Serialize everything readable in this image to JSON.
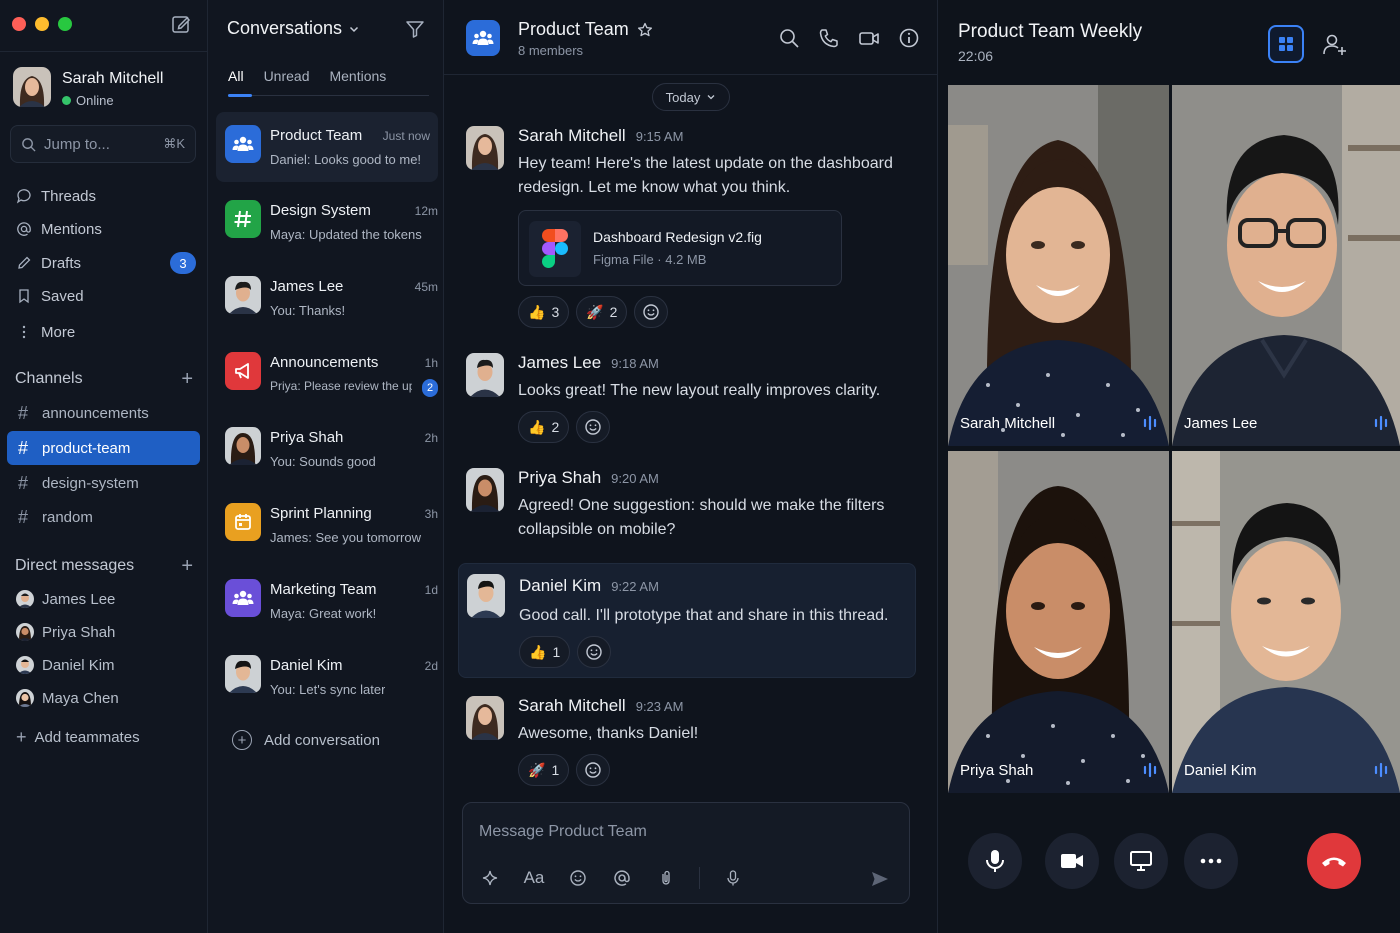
{
  "colors": {
    "accent": "#2b6cd9",
    "online": "#35c46a",
    "end_call": "#e0383b"
  },
  "user": {
    "name": "Sarah Mitchell",
    "status": "Online"
  },
  "search": {
    "placeholder": "Jump to...",
    "shortcut": "⌘K"
  },
  "nav": [
    {
      "label": "Threads",
      "icon": "threads-icon"
    },
    {
      "label": "Mentions",
      "icon": "at-icon"
    },
    {
      "label": "Drafts",
      "icon": "pencil-icon",
      "badge": "3"
    },
    {
      "label": "Saved",
      "icon": "bookmark-icon"
    },
    {
      "label": "More",
      "icon": "more-vertical-icon"
    }
  ],
  "channels": {
    "title": "Channels",
    "items": [
      "announcements",
      "product-team",
      "design-system",
      "random"
    ],
    "active": "product-team"
  },
  "dms": {
    "title": "Direct messages",
    "items": [
      "James Lee",
      "Priya Shah",
      "Daniel Kim",
      "Maya Chen"
    ],
    "add_label": "Add teammates"
  },
  "conversations": {
    "title": "Conversations",
    "tabs": [
      "All",
      "Unread",
      "Mentions"
    ],
    "items": [
      {
        "name": "Product Team",
        "time": "Just now",
        "preview": "Daniel: Looks good to me!",
        "icon": "people-icon",
        "color": "#2b6cd9"
      },
      {
        "name": "Design System",
        "time": "12m",
        "preview": "Maya: Updated the tokens",
        "icon": "hash-icon",
        "color": "#22a447"
      },
      {
        "name": "James Lee",
        "time": "45m",
        "preview": "You: Thanks!",
        "icon": "avatar"
      },
      {
        "name": "Announcements",
        "time": "1h",
        "preview": "Priya: Please review the upda...",
        "icon": "megaphone-icon",
        "color": "#e0383b",
        "badge": "2"
      },
      {
        "name": "Priya Shah",
        "time": "2h",
        "preview": "You: Sounds good",
        "icon": "avatar"
      },
      {
        "name": "Sprint Planning",
        "time": "3h",
        "preview": "James: See you tomorrow",
        "icon": "calendar-icon",
        "color": "#e9a020"
      },
      {
        "name": "Marketing Team",
        "time": "1d",
        "preview": "Maya: Great work!",
        "icon": "people-icon",
        "color": "#6a4fd8"
      },
      {
        "name": "Daniel Kim",
        "time": "2d",
        "preview": "You: Let's sync later",
        "icon": "avatar"
      }
    ],
    "add_label": "Add conversation"
  },
  "chat": {
    "title": "Product Team",
    "members": "8 members",
    "day": "Today",
    "messages": [
      {
        "author": "Sarah Mitchell",
        "time": "9:15 AM",
        "text": "Hey team! Here's the latest update on the dashboard redesign. Let me know what you think.",
        "file": {
          "name": "Dashboard Redesign v2.fig",
          "meta": "Figma File · 4.2 MB"
        },
        "reactions": [
          {
            "emoji": "👍",
            "count": "3"
          },
          {
            "emoji": "🚀",
            "count": "2"
          }
        ]
      },
      {
        "author": "James Lee",
        "time": "9:18 AM",
        "text": "Looks great! The new layout really improves clarity.",
        "reactions": [
          {
            "emoji": "👍",
            "count": "2"
          }
        ]
      },
      {
        "author": "Priya Shah",
        "time": "9:20 AM",
        "text": "Agreed! One suggestion: should we make the filters collapsible on mobile?"
      },
      {
        "author": "Daniel Kim",
        "time": "9:22 AM",
        "text": "Good call. I'll prototype that and share in this thread.",
        "reactions": [
          {
            "emoji": "👍",
            "count": "1"
          }
        ]
      },
      {
        "author": "Sarah Mitchell",
        "time": "9:23 AM",
        "text": "Awesome, thanks Daniel!",
        "reactions": [
          {
            "emoji": "🚀",
            "count": "1"
          }
        ]
      }
    ],
    "composer_placeholder": "Message Product Team",
    "format_label": "Aa"
  },
  "call": {
    "title": "Product Team Weekly",
    "time": "22:06",
    "participants": [
      "Sarah Mitchell",
      "James Lee",
      "Priya Shah",
      "Daniel Kim"
    ]
  }
}
